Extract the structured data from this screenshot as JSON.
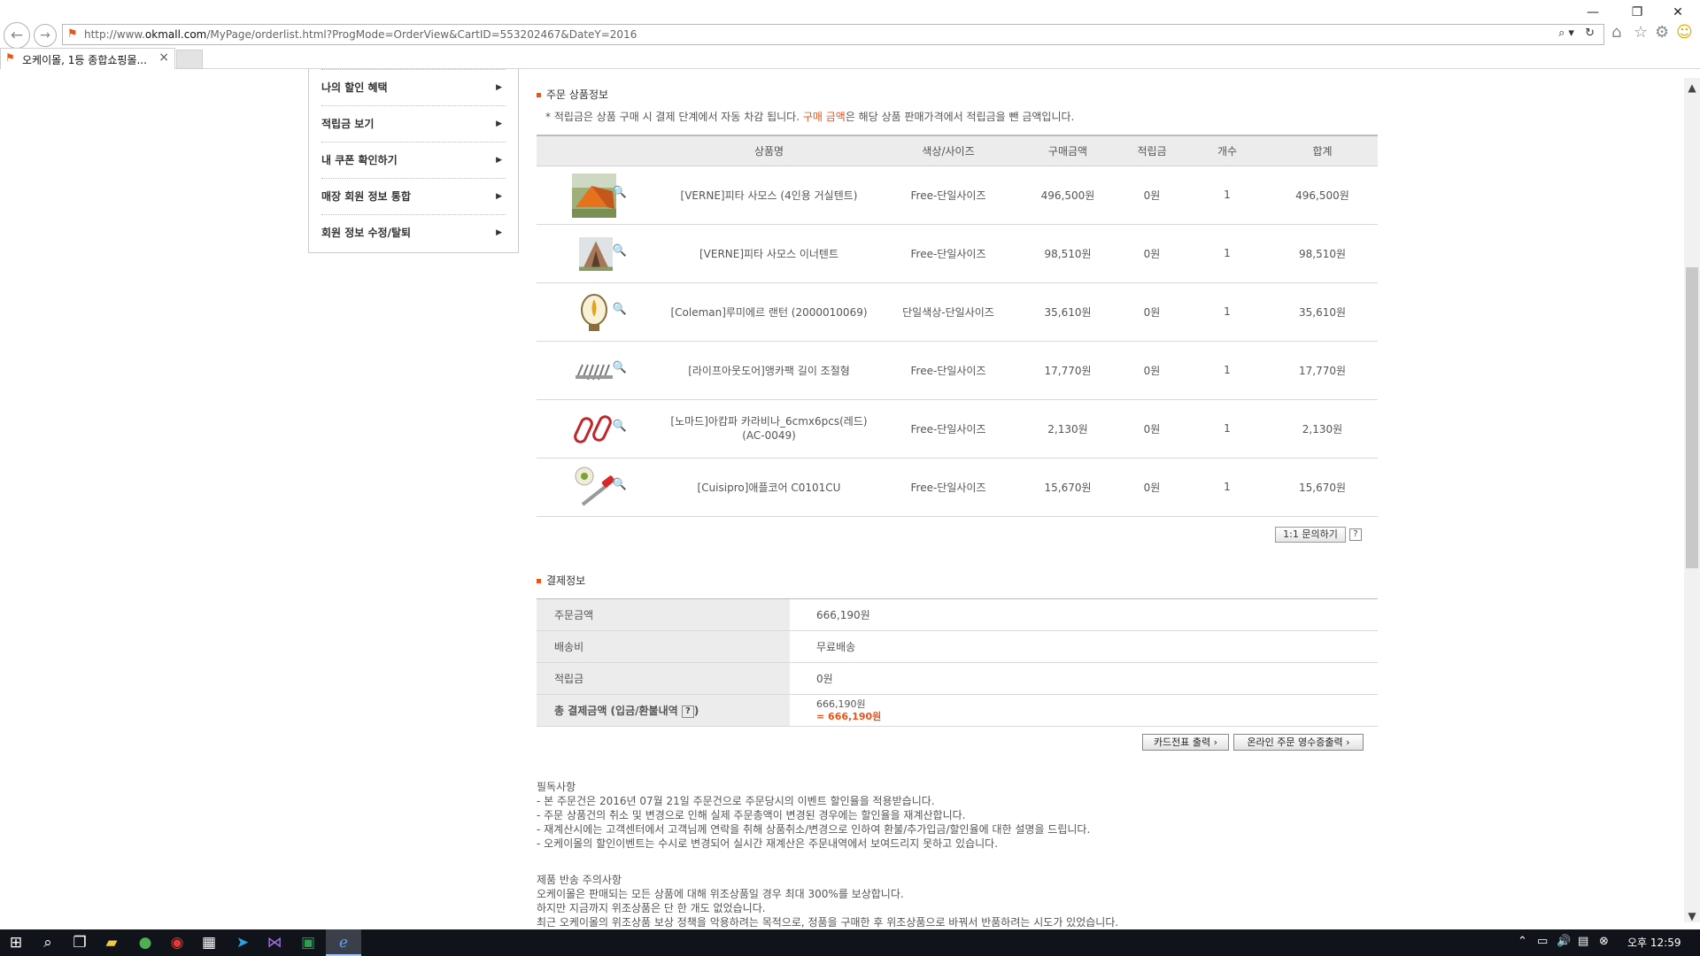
{
  "browser": {
    "url_prefix": "http://www.",
    "url_domain": "okmall.com",
    "url_suffix": "/MyPage/orderlist.html?ProgMode=OrderView&CartID=553202467&DateY=2016",
    "tab_title": "오케이몰, 1등 종합쇼핑몰...",
    "tab_close": "×",
    "win_min": "—",
    "win_restore": "❐",
    "win_close": "✕",
    "back": "←",
    "forward": "→",
    "addr_tools": "⌕▾ ↻"
  },
  "side_menu": {
    "items": [
      {
        "label": "나의 할인 혜택"
      },
      {
        "label": "적립금 보기"
      },
      {
        "label": "내 쿠폰 확인하기"
      },
      {
        "label": "매장 회원 정보 통합"
      },
      {
        "label": "회원 정보 수정/탈퇴"
      }
    ]
  },
  "order_section": {
    "title": "주문 상품정보",
    "note_prefix": "* 적립금은 상품 구매 시 결제 단계에서 자동 차감 됩니다. ",
    "note_highlight": "구매 금액",
    "note_suffix": "은 해당 상품 판매가격에서 적립금을 뺀 금액입니다.",
    "columns": [
      "상품명",
      "색상/사이즈",
      "구매금액",
      "적립금",
      "개수",
      "합계"
    ],
    "rows": [
      {
        "name": "[VERNE]피타 사모스 (4인용 거실텐트)",
        "option": "Free-단일사이즈",
        "price": "496,500원",
        "points": "0원",
        "qty": "1",
        "total": "496,500원",
        "thumb": "tent-orange"
      },
      {
        "name": "[VERNE]피타 사모스 이너텐트",
        "option": "Free-단일사이즈",
        "price": "98,510원",
        "points": "0원",
        "qty": "1",
        "total": "98,510원",
        "thumb": "tent-inner"
      },
      {
        "name": "[Coleman]루미에르 랜턴 (2000010069)",
        "option": "단일색상-단일사이즈",
        "price": "35,610원",
        "points": "0원",
        "qty": "1",
        "total": "35,610원",
        "thumb": "lantern"
      },
      {
        "name": "[라이프아웃도어]앵카팩 길이 조절형",
        "option": "Free-단일사이즈",
        "price": "17,770원",
        "points": "0원",
        "qty": "1",
        "total": "17,770원",
        "thumb": "pegs"
      },
      {
        "name": "[노마드]아캄파 카라비나_6cmx6pcs(레드)\n(AC-0049)",
        "option": "Free-단일사이즈",
        "price": "2,130원",
        "points": "0원",
        "qty": "1",
        "total": "2,130원",
        "thumb": "carabiner"
      },
      {
        "name": "[Cuisipro]애플코어 C0101CU",
        "option": "Free-단일사이즈",
        "price": "15,670원",
        "points": "0원",
        "qty": "1",
        "total": "15,670원",
        "thumb": "corer"
      }
    ],
    "qna_button": "1:1 문의하기",
    "help": "?"
  },
  "payment_section": {
    "title": "결제정보",
    "rows": [
      {
        "key": "주문금액",
        "value": "666,190원"
      },
      {
        "key": "배송비",
        "value": "무료배송"
      },
      {
        "key": "적립금",
        "value": "0원"
      }
    ],
    "total_key": "총 결제금액 (입금/환불내역",
    "total_key_close": ")",
    "total_line1": "666,190원",
    "total_line2": "= 666,190원",
    "btn_card": "카드전표 출력",
    "btn_receipt": "온라인 주문 영수증출력"
  },
  "notice": {
    "title": "필독사항",
    "lines": [
      "- 본 주문건은 2016년 07월 21일 주문건으로 주문당시의 이벤트 할인율을 적용받습니다.",
      "- 주문 상품건의 취소 및 변경으로 인해 실제 주문총액이 변경된 경우에는 할인율을 재계산합니다.",
      "- 재계산시에는 고객센터에서 고객님께 연락을 취해 상품취소/변경으로 인하여 환불/추가입금/할인율에 대한 설명을 드립니다.",
      "- 오케이몰의 할인이벤트는 수시로 변경되어 실시간 재계산은 주문내역에서 보여드리지 못하고 있습니다."
    ]
  },
  "return_notice": {
    "title": "제품 반송 주의사항",
    "lines": [
      "오케이몰은 판매되는 모든 상품에 대해 위조상품일 경우 최대 300%를 보상합니다.",
      "하지만 지금까지 위조상품은 단 한 개도 없었습니다.",
      "최근 오케이몰의 위조상품 보상 정책을 악용하려는 목적으로, 정품을 구매한 후 위조상품으로 바꿔서 반품하려는 시도가 있었습니다."
    ]
  },
  "taskbar": {
    "clock": "오후 12:59"
  }
}
